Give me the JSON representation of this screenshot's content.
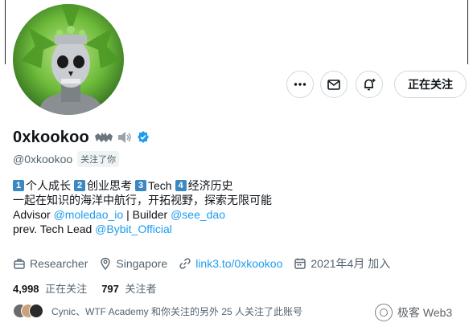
{
  "actions": {
    "more_icon": "more-icon",
    "message_icon": "message-icon",
    "notify_icon": "notification-bell-icon",
    "follow_label": "正在关注"
  },
  "profile": {
    "display_name": "0xkookoo",
    "name_emojis": "bat-emoji speaker-emoji",
    "verified": true,
    "handle": "@0xkookoo",
    "follows_you": "关注了你"
  },
  "bio": {
    "topics": [
      {
        "num": "1",
        "label": "个人成长"
      },
      {
        "num": "2",
        "label": "创业思考"
      },
      {
        "num": "3",
        "label": "Tech"
      },
      {
        "num": "4",
        "label": "经济历史"
      }
    ],
    "line2": "一起在知识的海洋中航行，开拓视野，探索无限可能",
    "line3_prefix": "Advisor ",
    "line3_link1": "@moledao_io",
    "line3_mid": " | Builder ",
    "line3_link2": "@see_dao",
    "line4_prefix": "prev. Tech Lead ",
    "line4_link": "@Bybit_Official"
  },
  "meta": {
    "job": "Researcher",
    "location": "Singapore",
    "website": "link3.to/0xkookoo",
    "joined": "2021年4月 加入"
  },
  "counts": {
    "following_num": "4,998",
    "following_label": "正在关注",
    "followers_num": "797",
    "followers_label": "关注者"
  },
  "followed_by": {
    "text": "Cynic、WTF Academy 和你关注的另外 25 人关注了此账号"
  },
  "watermark": {
    "text": "极客 Web3"
  },
  "colors": {
    "accent": "#1d9bf0",
    "text": "#0f1419",
    "secondary": "#536471",
    "keycap": "#3b88c3"
  }
}
